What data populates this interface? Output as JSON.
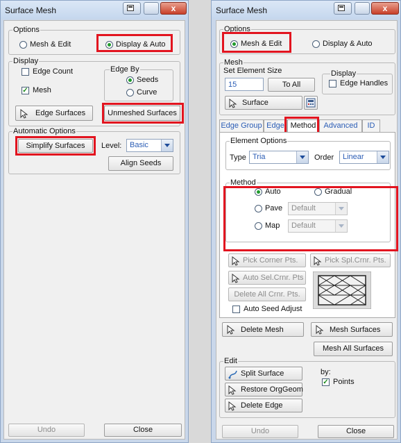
{
  "left": {
    "title": "Surface Mesh",
    "options": {
      "label": "Options",
      "mesh_edit": "Mesh & Edit",
      "display_auto": "Display & Auto"
    },
    "display": {
      "label": "Display",
      "edge_count": "Edge Count",
      "mesh": "Mesh",
      "edge_by": {
        "label": "Edge By",
        "seeds": "Seeds",
        "curve": "Curve"
      },
      "edge_surfaces": "Edge Surfaces",
      "unmeshed_surfaces": "Unmeshed Surfaces"
    },
    "auto": {
      "label": "Automatic Options",
      "simplify": "Simplify Surfaces",
      "level_label": "Level:",
      "level_value": "Basic",
      "align_seeds": "Align Seeds"
    },
    "undo": "Undo",
    "close": "Close"
  },
  "right": {
    "title": "Surface Mesh",
    "options": {
      "label": "Options",
      "mesh_edit": "Mesh & Edit",
      "display_auto": "Display & Auto"
    },
    "mesh": {
      "label": "Mesh",
      "set_size_label": "Set Element Size",
      "size_value": "15",
      "to_all": "To All",
      "surface": "Surface",
      "display_label": "Display",
      "edge_handles": "Edge Handles"
    },
    "tabs": [
      "Edge Group",
      "Edge",
      "Method",
      "Advanced",
      "ID"
    ],
    "element_options": {
      "label": "Element Options",
      "type_label": "Type",
      "type_value": "Tria",
      "order_label": "Order",
      "order_value": "Linear"
    },
    "method": {
      "label": "Method",
      "auto": "Auto",
      "gradual": "Gradual",
      "pave": "Pave",
      "pave_value": "Default",
      "map": "Map",
      "map_value": "Default"
    },
    "pick_corner": "Pick Corner Pts.",
    "pick_spl": "Pick Spl.Crnr. Pts.",
    "auto_sel": "Auto Sel.Crnr. Pts",
    "delete_all": "Delete All Crnr. Pts.",
    "auto_seed": "Auto Seed Adjust",
    "delete_mesh": "Delete Mesh",
    "mesh_surfaces": "Mesh Surfaces",
    "mesh_all": "Mesh All Surfaces",
    "edit": {
      "label": "Edit",
      "split": "Split Surface",
      "restore": "Restore OrgGeom",
      "delete_edge": "Delete Edge",
      "by_label": "by:",
      "points": "Points"
    },
    "undo": "Undo",
    "close": "Close"
  },
  "colors": {
    "highlight": "#e2141f",
    "title_bg": "#c9d7ea",
    "link_blue": "#2b5db5"
  }
}
